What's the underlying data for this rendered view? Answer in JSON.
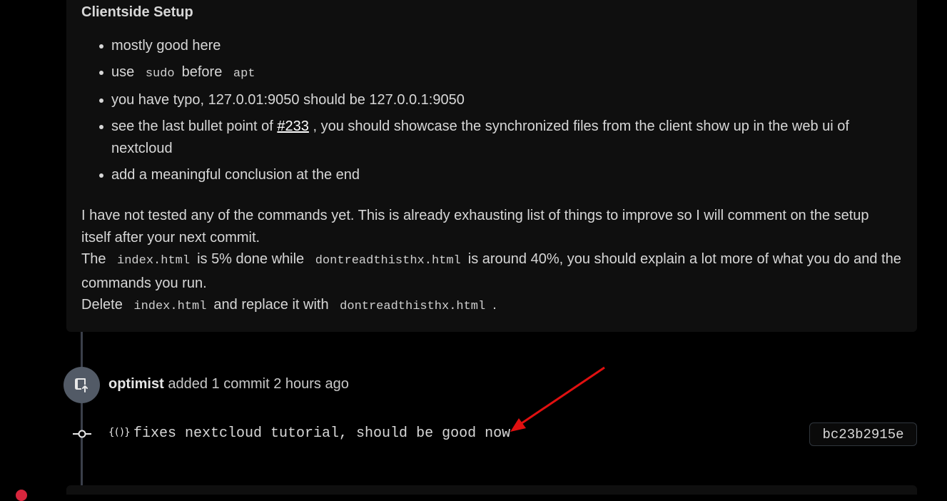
{
  "comment": {
    "heading": "Clientside Setup",
    "bullets": {
      "b1": "mostly good here",
      "b2_pre": "use",
      "b2_code1": "sudo",
      "b2_mid": "before",
      "b2_code2": "apt",
      "b3": "you have typo, 127.0.01:9050 should be 127.0.0.1:9050",
      "b4_pre": "see the last bullet point of",
      "b4_link": "#233",
      "b4_post": ", you should showcase the synchronized files from the client show up in the web ui of nextcloud",
      "b5": "add a meaningful conclusion at the end"
    },
    "para": {
      "line1": "I have not tested any of the commands yet. This is already exhausting list of things to improve so I will comment on the setup itself after your next commit.",
      "line2_pre": "The",
      "line2_code1": "index.html",
      "line2_mid": "is 5% done while",
      "line2_code2": "dontreadthisthx.html",
      "line2_post": "is around 40%, you should explain a lot more of what you do and the commands you run.",
      "line3_pre": "Delete",
      "line3_code1": "index.html",
      "line3_mid": "and replace it with",
      "line3_code2": "dontreadthisthx.html",
      "line3_post": "."
    }
  },
  "event": {
    "author": "optimist",
    "action": "added 1 commit 2 hours ago",
    "avatar_icon": "repo-push-icon"
  },
  "commit": {
    "icon_text": "{()}",
    "message": "fixes nextcloud tutorial, should be good now",
    "sha": "bc23b2915e"
  },
  "colors": {
    "background": "#000000",
    "comment_bg": "#0f0f0f",
    "timeline": "#3a3f4a",
    "avatar_bg": "#525a66",
    "annotation_arrow": "#e01010"
  }
}
